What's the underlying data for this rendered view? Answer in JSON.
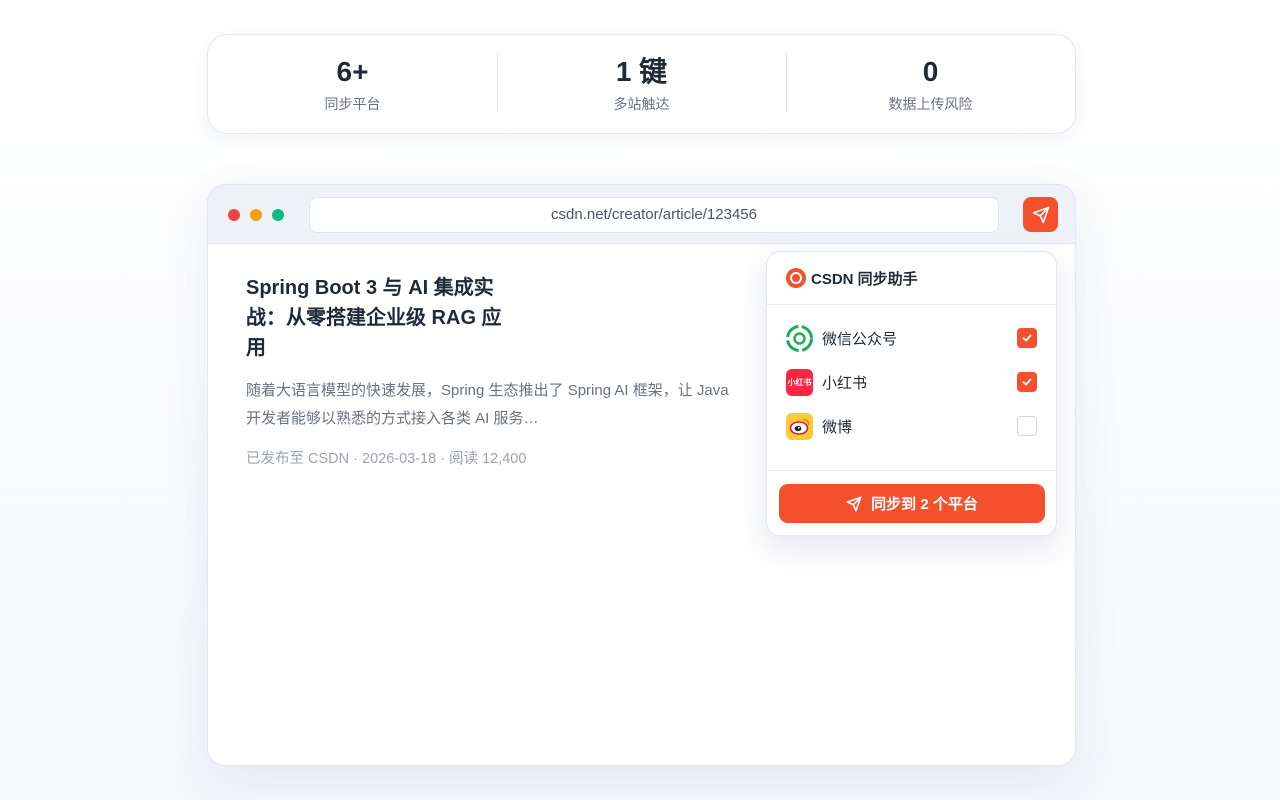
{
  "stats": [
    {
      "value": "6+",
      "label": "同步平台"
    },
    {
      "value": "1 键",
      "label": "多站触达"
    },
    {
      "value": "0",
      "label": "数据上传风险"
    }
  ],
  "browser": {
    "url": "csdn.net/creator/article/123456"
  },
  "article": {
    "title": "Spring Boot 3 与 AI 集成实战：从零搭建企业级 RAG 应用",
    "excerpt": "随着大语言模型的快速发展，Spring 生态推出了 Spring AI 框架，让 Java 开发者能够以熟悉的方式接入各类 AI 服务…",
    "meta": "已发布至 CSDN · 2026-03-18 · 阅读 12,400"
  },
  "popup": {
    "title": "CSDN 同步助手",
    "platforms": [
      {
        "name": "微信公众号",
        "icon": "wechat-icon",
        "checked": true
      },
      {
        "name": "小红书",
        "icon": "xiaohongshu-icon",
        "icon_text": "小红书",
        "checked": true
      },
      {
        "name": "微博",
        "icon": "weibo-icon",
        "checked": false
      }
    ],
    "sync_button": "同步到 2 个平台"
  },
  "colors": {
    "accent": "#f5502d",
    "text": "#1f2937",
    "muted": "#6b7280"
  }
}
